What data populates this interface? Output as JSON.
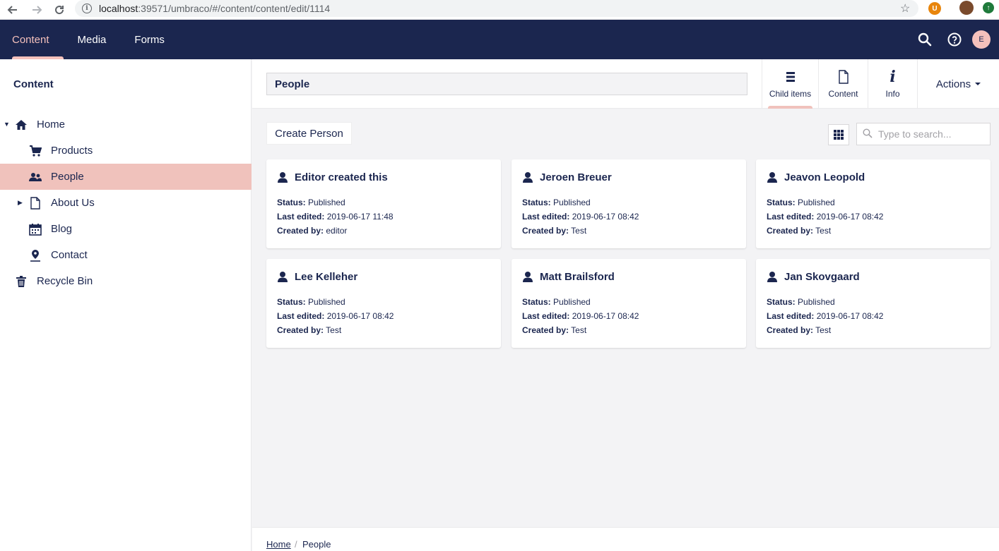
{
  "browser": {
    "url_host": "localhost",
    "url_rest": ":39571/umbraco/#/content/content/edit/1114"
  },
  "header": {
    "sections": [
      "Content",
      "Media",
      "Forms"
    ],
    "active_section": "Content",
    "user_initial": "E"
  },
  "sidebar": {
    "title": "Content",
    "tree": [
      {
        "label": "Home",
        "icon": "home-icon",
        "expanded": true
      },
      {
        "label": "Products",
        "icon": "shopping-cart-icon"
      },
      {
        "label": "People",
        "icon": "users-icon",
        "selected": true
      },
      {
        "label": "About Us",
        "icon": "document-icon",
        "has_children": true
      },
      {
        "label": "Blog",
        "icon": "calendar-icon"
      },
      {
        "label": "Contact",
        "icon": "map-pin-icon"
      },
      {
        "label": "Recycle Bin",
        "icon": "trash-icon"
      }
    ]
  },
  "editor": {
    "name": "People",
    "apps": [
      {
        "label": "Child items",
        "icon": "list-icon",
        "active": true
      },
      {
        "label": "Content",
        "icon": "document-icon"
      },
      {
        "label": "Info",
        "icon": "info-icon"
      }
    ],
    "actions_label": "Actions"
  },
  "listview": {
    "create_label": "Create Person",
    "search_placeholder": "Type to search...",
    "labels": {
      "status": "Status:",
      "last_edited": "Last edited:",
      "created_by": "Created by:"
    },
    "items": [
      {
        "name": "Editor created this",
        "status": "Published",
        "last_edited": "2019-06-17 11:48",
        "created_by": "editor"
      },
      {
        "name": "Jeroen Breuer",
        "status": "Published",
        "last_edited": "2019-06-17 08:42",
        "created_by": "Test"
      },
      {
        "name": "Jeavon Leopold",
        "status": "Published",
        "last_edited": "2019-06-17 08:42",
        "created_by": "Test"
      },
      {
        "name": "Lee Kelleher",
        "status": "Published",
        "last_edited": "2019-06-17 08:42",
        "created_by": "Test"
      },
      {
        "name": "Matt Brailsford",
        "status": "Published",
        "last_edited": "2019-06-17 08:42",
        "created_by": "Test"
      },
      {
        "name": "Jan Skovgaard",
        "status": "Published",
        "last_edited": "2019-06-17 08:42",
        "created_by": "Test"
      }
    ]
  },
  "breadcrumb": {
    "items": [
      "Home",
      "People"
    ],
    "separator": "/"
  },
  "colors": {
    "brand_navy": "#1b264f",
    "accent_pink": "#f5c1bc",
    "selected_row": "#f0c2bc",
    "background": "#f3f3f5"
  }
}
